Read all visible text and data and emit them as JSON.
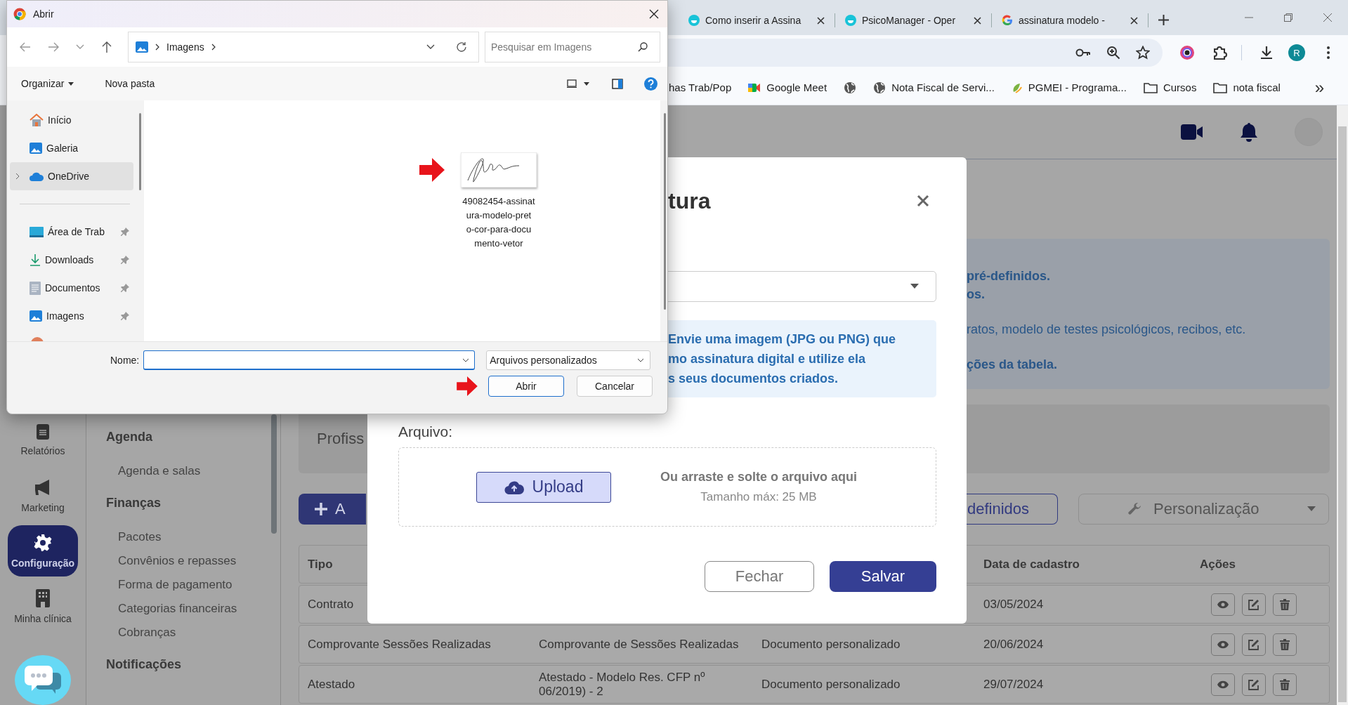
{
  "browser": {
    "tabs": [
      {
        "title": "Como inserir a Assina",
        "kind": "psico",
        "selected": false
      },
      {
        "title": "PsicoManager - Oper",
        "kind": "psico",
        "selected": false
      },
      {
        "title": "assinatura modelo - ",
        "kind": "google",
        "selected": false
      }
    ],
    "profile_initial": "R",
    "bookmarks": [
      {
        "kind": "plain",
        "label": "has Trab/Pop"
      },
      {
        "kind": "meet",
        "label": "Google Meet"
      },
      {
        "kind": "globe"
      },
      {
        "kind": "globe",
        "label": "Nota Fiscal de Servi..."
      },
      {
        "kind": "pgmei",
        "label": "PGMEI - Programa..."
      },
      {
        "kind": "folder",
        "label": "Cursos"
      },
      {
        "kind": "folder",
        "label": "nota fiscal"
      }
    ],
    "bookmarks_overflow": "»"
  },
  "page": {
    "rail": [
      {
        "kind": "report",
        "label": "Relatórios",
        "selected": false
      },
      {
        "kind": "megaphone",
        "label": "Marketing",
        "selected": false
      },
      {
        "kind": "gear",
        "label": "Configuração",
        "selected": true
      },
      {
        "kind": "building",
        "label": "Minha clínica",
        "selected": false
      }
    ],
    "submenu": [
      {
        "heading": "Agenda",
        "items": [
          "Agenda e salas"
        ]
      },
      {
        "heading": "Finanças",
        "items": [
          "Pacotes",
          "Convênios e repasses",
          "Forma de pagamento",
          "Categorias financeiras",
          "Cobranças"
        ]
      },
      {
        "heading": "Notificações"
      }
    ],
    "info_lines": [
      {
        "text": "pré-definidos.",
        "bold": true
      },
      {
        "text": "os.",
        "bold": true
      },
      {
        "text": "ratos, modelo de testes psicológicos, recibos, etc.",
        "bold": false
      },
      {
        "text": "ções da tabela.",
        "bold": true
      }
    ],
    "profile_box": "Profiss",
    "add_button": "A",
    "predefined_button": "definidos",
    "customize_dropdown": "Personalização",
    "table": {
      "columns": {
        "tipo": "Tipo",
        "data_de_cadastro": "Data de cadastro",
        "acoes": "Ações"
      },
      "rows": [
        {
          "tipo": "Contrato",
          "data_de_cadastro": "03/05/2024"
        },
        {
          "tipo": "Comprovante Sessões Realizadas",
          "column_2": "Comprovante de Sessões Realizadas",
          "column_3": "Documento personalizado",
          "data_de_cadastro": "20/06/2024"
        },
        {
          "tipo": "Atestado",
          "column_2": "Atestado - Modelo Res. CFP nº 06/2019) - 2",
          "column_3": "Documento personalizado",
          "data_de_cadastro": "29/07/2024"
        }
      ]
    }
  },
  "modal": {
    "title": "tura",
    "info_lines": [
      "Envie uma imagem (JPG ou PNG) que",
      "mo assinatura digital e utilize ela",
      "s seus documentos criados."
    ],
    "file_label": "Arquivo:",
    "upload_button": "Upload",
    "drop_hint": "Ou arraste e solte o arquivo aqui",
    "max_size": "Tamanho máx: 25 MB",
    "close_button": "Fechar",
    "save_button": "Salvar"
  },
  "file_dialog": {
    "title": "Abrir",
    "breadcrumb": "Imagens",
    "search_placeholder": "Pesquisar em Imagens",
    "organize_button": "Organizar",
    "new_folder_button": "Nova pasta",
    "sidebar": [
      {
        "kind": "home",
        "label": "Início",
        "selected": false
      },
      {
        "kind": "gallery",
        "label": "Galeria",
        "selected": false
      },
      {
        "kind": "cloud",
        "label": "OneDrive",
        "selected": true,
        "expanded": false
      },
      {
        "kind": "desktop",
        "label": "Área de Trab",
        "selected": false,
        "pinned": true,
        "separator_before": true
      },
      {
        "kind": "download",
        "label": "Downloads",
        "selected": false,
        "pinned": true
      },
      {
        "kind": "document",
        "label": "Documentos",
        "selected": false,
        "pinned": true
      },
      {
        "kind": "gallery",
        "label": "Imagens",
        "selected": false,
        "pinned": true
      }
    ],
    "files": [
      {
        "name_lines": [
          "49082454-assinat",
          "ura-modelo-pret",
          "o-cor-para-docu",
          "mento-vetor"
        ],
        "pointed": true
      }
    ],
    "name_label": "Nome:",
    "file_type": "Arquivos personalizados",
    "open_button": "Abrir",
    "open_pointed": true,
    "cancel_button": "Cancelar"
  }
}
